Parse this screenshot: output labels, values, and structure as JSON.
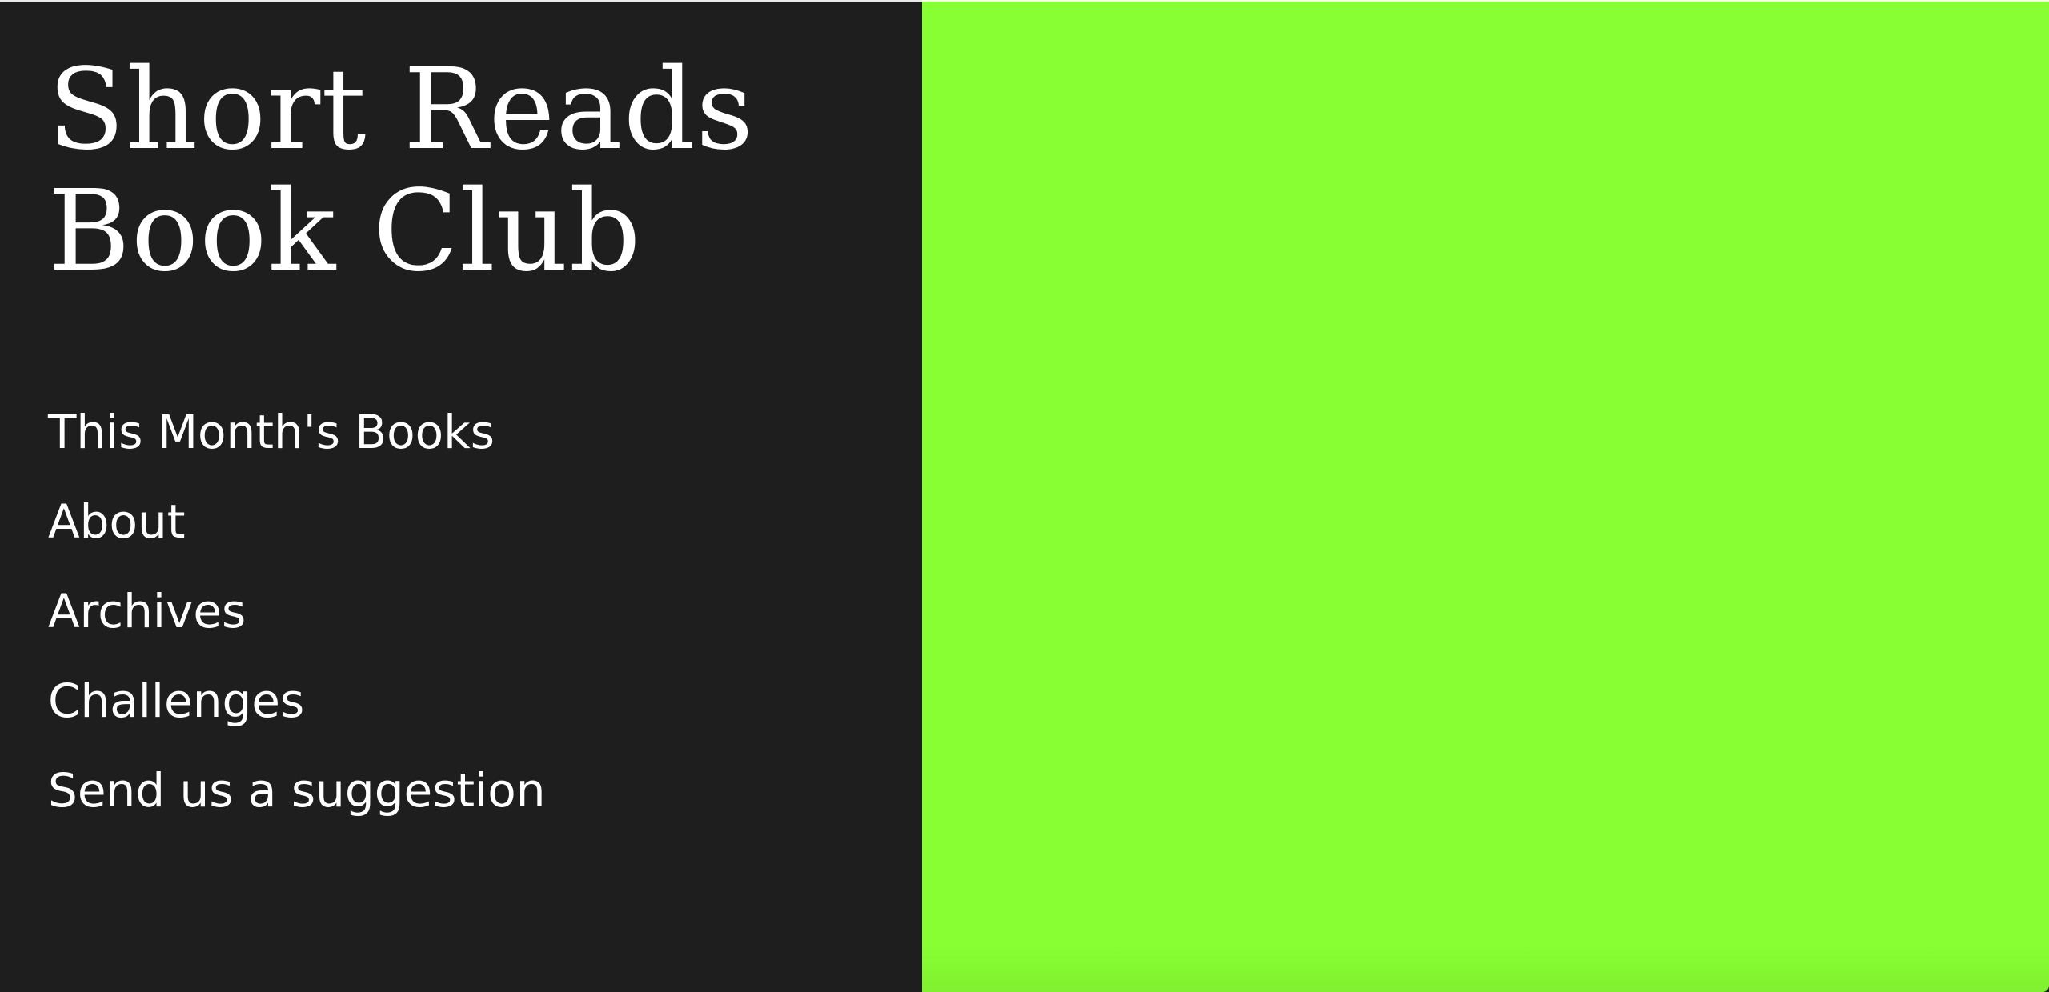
{
  "site": {
    "title_line1": "Short Reads",
    "title_line2": "Book Club"
  },
  "nav": {
    "items": [
      {
        "label": "This Month's Books"
      },
      {
        "label": "About"
      },
      {
        "label": "Archives"
      },
      {
        "label": "Challenges"
      },
      {
        "label": "Send us a suggestion"
      }
    ]
  },
  "colors": {
    "sidebar_background": "#1e1e1e",
    "hero_background": "#88ff33",
    "text": "#ffffff"
  }
}
